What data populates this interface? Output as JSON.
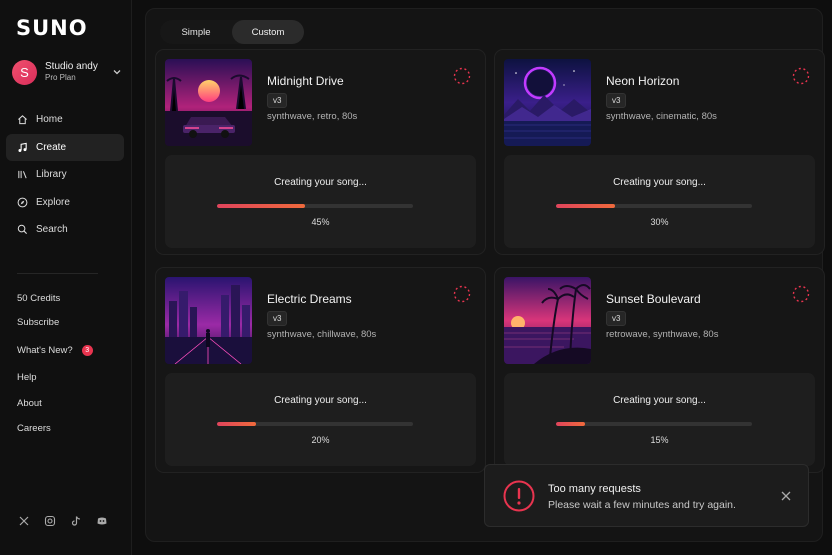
{
  "app": {
    "logo": "SUNO"
  },
  "user": {
    "initial": "S",
    "name": "Studio andy",
    "plan": "Pro Plan"
  },
  "nav": [
    {
      "label": "Home",
      "icon": "home-icon"
    },
    {
      "label": "Create",
      "icon": "music-note-icon",
      "active": true
    },
    {
      "label": "Library",
      "icon": "library-icon"
    },
    {
      "label": "Explore",
      "icon": "compass-icon"
    },
    {
      "label": "Search",
      "icon": "search-icon"
    }
  ],
  "links": {
    "credits": "50 Credits",
    "subscribe": "Subscribe",
    "whats_new": "What's New?",
    "whats_new_badge": "3",
    "help": "Help",
    "about": "About",
    "careers": "Careers"
  },
  "socials": [
    "x-icon",
    "instagram-icon",
    "tiktok-icon",
    "discord-icon"
  ],
  "mode_tabs": {
    "simple": "Simple",
    "custom": "Custom",
    "active": "custom"
  },
  "songs": [
    {
      "title": "Midnight Drive",
      "version": "v3",
      "tags": "synthwave, retro, 80s",
      "status": "Creating your song...",
      "progress": 45,
      "progress_label": "45%"
    },
    {
      "title": "Neon Horizon",
      "version": "v3",
      "tags": "synthwave, cinematic, 80s",
      "status": "Creating your song...",
      "progress": 30,
      "progress_label": "30%"
    },
    {
      "title": "Electric Dreams",
      "version": "v3",
      "tags": "synthwave, chillwave, 80s",
      "status": "Creating your song...",
      "progress": 20,
      "progress_label": "20%"
    },
    {
      "title": "Sunset Boulevard",
      "version": "v3",
      "tags": "retrowave, synthwave, 80s",
      "status": "Creating your song...",
      "progress": 15,
      "progress_label": "15%"
    }
  ],
  "toast": {
    "title": "Too many requests",
    "message": "Please wait a few minutes and try again."
  },
  "colors": {
    "accent": "#e8344f",
    "progress_start": "#e0445c",
    "progress_end": "#f06a3c"
  }
}
